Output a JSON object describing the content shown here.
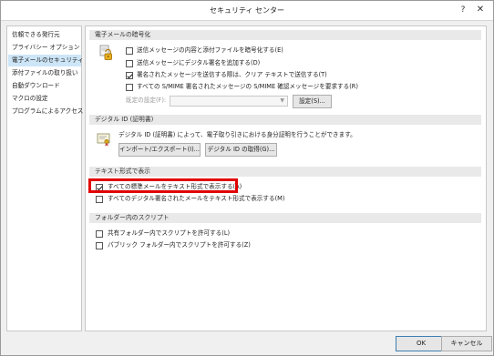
{
  "window": {
    "title": "セキュリティ センター",
    "help_glyph": "?",
    "close_glyph": "✕"
  },
  "sidebar": {
    "items": [
      {
        "label": "信頼できる発行元"
      },
      {
        "label": "プライバシー オプション"
      },
      {
        "label": "電子メールのセキュリティ",
        "selected": true
      },
      {
        "label": "添付ファイルの取り扱い"
      },
      {
        "label": "自動ダウンロード"
      },
      {
        "label": "マクロの設定"
      },
      {
        "label": "プログラムによるアクセス"
      }
    ]
  },
  "email_encryption": {
    "heading": "電子メールの暗号化",
    "icon": "lock-icon",
    "options": [
      {
        "label": "送信メッセージの内容と添付ファイルを暗号化する(E)",
        "checked": false
      },
      {
        "label": "送信メッセージにデジタル署名を追加する(D)",
        "checked": false
      },
      {
        "label": "署名されたメッセージを送信する際は、クリア テキストで送信する(T)",
        "checked": true
      },
      {
        "label": "すべての S/MIME 署名されたメッセージの S/MIME 確認メッセージを要求する(R)",
        "checked": false
      }
    ],
    "default_setting_label": "既定の設定(F):",
    "default_setting_value": "",
    "settings_button": "設定(S)..."
  },
  "digital_id": {
    "heading": "デジタル ID (証明書)",
    "icon": "certificate-icon",
    "description": "デジタル ID (証明書) によって、電子取り引きにおける身分証明を行うことができます。",
    "import_export_button": "インポート/エクスポート(I)...",
    "get_id_button": "デジタル ID の取得(G)..."
  },
  "plain_text": {
    "heading": "テキスト形式で表示",
    "options": [
      {
        "label": "すべての標準メールをテキスト形式で表示する(A)",
        "checked": true
      },
      {
        "label": "すべてのデジタル署名されたメールをテキスト形式で表示する(M)",
        "checked": false
      }
    ]
  },
  "folder_scripts": {
    "heading": "フォルダー内のスクリプト",
    "options": [
      {
        "label": "共有フォルダー内でスクリプトを許可する(L)",
        "checked": false
      },
      {
        "label": "パブリック フォルダー内でスクリプトを許可する(Z)",
        "checked": false
      }
    ]
  },
  "footer": {
    "ok": "OK",
    "cancel": "キャンセル"
  },
  "colors": {
    "highlight": "#e10000",
    "selected_item": "#cde6f7"
  }
}
